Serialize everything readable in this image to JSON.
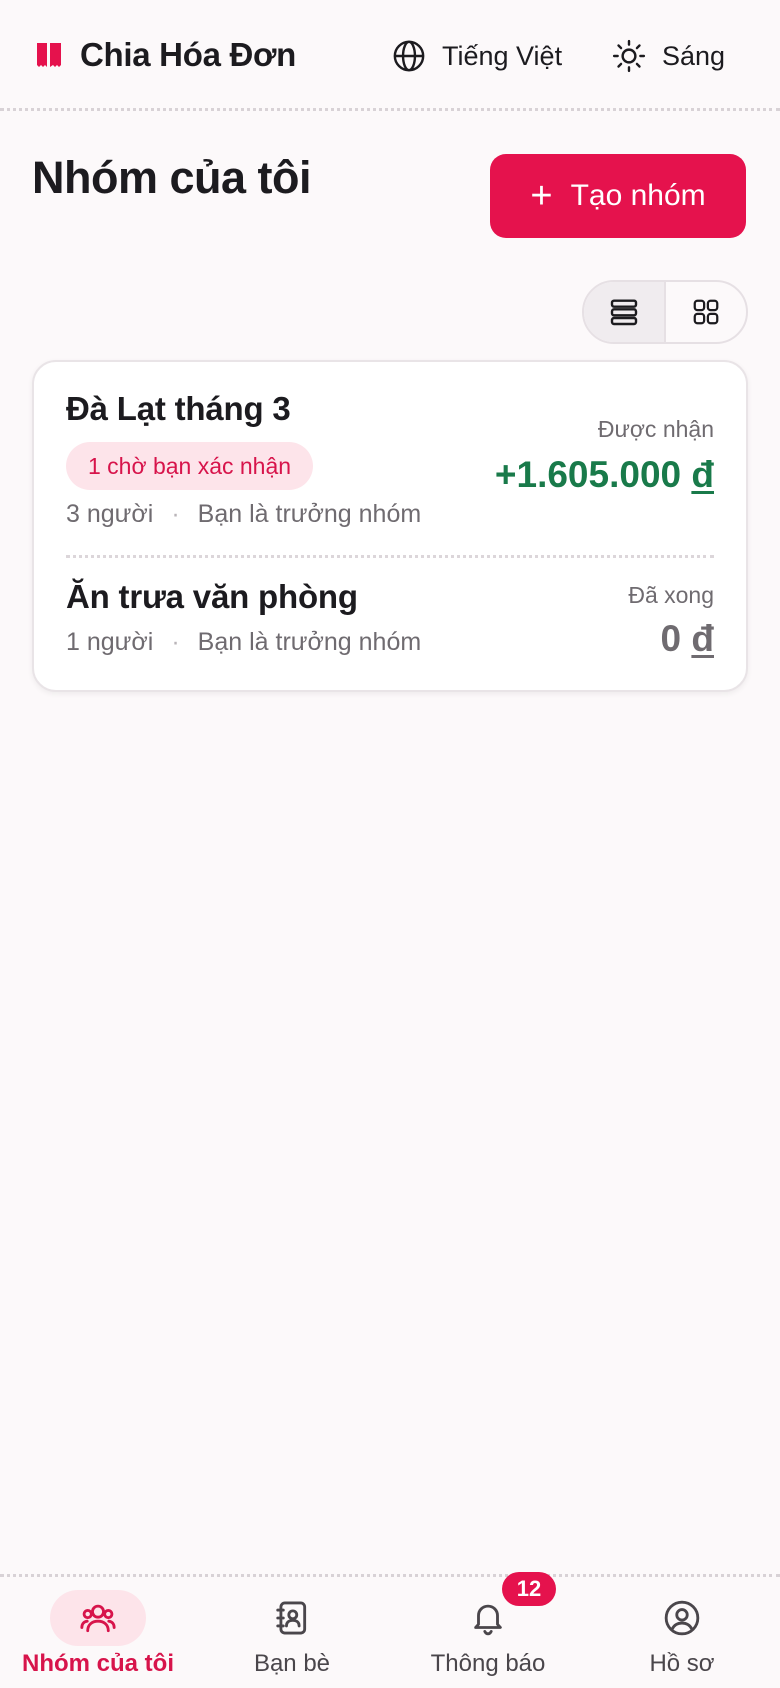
{
  "app": {
    "title": "Chia Hóa Đơn"
  },
  "header": {
    "language_label": "Tiếng Việt",
    "theme_label": "Sáng"
  },
  "page": {
    "title": "Nhóm của tôi",
    "create_button": {
      "icon": "+",
      "label": "Tạo nhóm"
    }
  },
  "view_toggle": {
    "options": [
      "list-view",
      "grid-view"
    ],
    "selected": "list-view"
  },
  "groups": [
    {
      "name": "Đà Lạt tháng 3",
      "badge": "1 chờ bạn xác nhận",
      "members": "3 người",
      "separator": "·",
      "role": "Bạn là trưởng nhóm",
      "status": "Được nhận",
      "amount_value": "+1.605.000",
      "currency": "đ"
    },
    {
      "name": "Ăn trưa văn phòng",
      "members": "1 người",
      "separator": "·",
      "role": "Bạn là trưởng nhóm",
      "status": "Đã xong",
      "amount_value": "0",
      "currency": "đ"
    }
  ],
  "bottom_nav": {
    "items": [
      {
        "label": "Nhóm của tôi",
        "icon": "users-icon",
        "active": true
      },
      {
        "label": "Bạn bè",
        "icon": "contacts-icon",
        "active": false
      },
      {
        "label": "Thông báo",
        "icon": "bell-icon",
        "active": false
      },
      {
        "label": "Hồ sơ",
        "icon": "profile-icon",
        "active": false
      }
    ],
    "notification_count": "12"
  },
  "colors": {
    "brand": "#e5124d",
    "positive": "#197a4a",
    "muted": "#6f6b70",
    "badge_bg": "#fde4ea",
    "background": "#fcf9fa"
  }
}
